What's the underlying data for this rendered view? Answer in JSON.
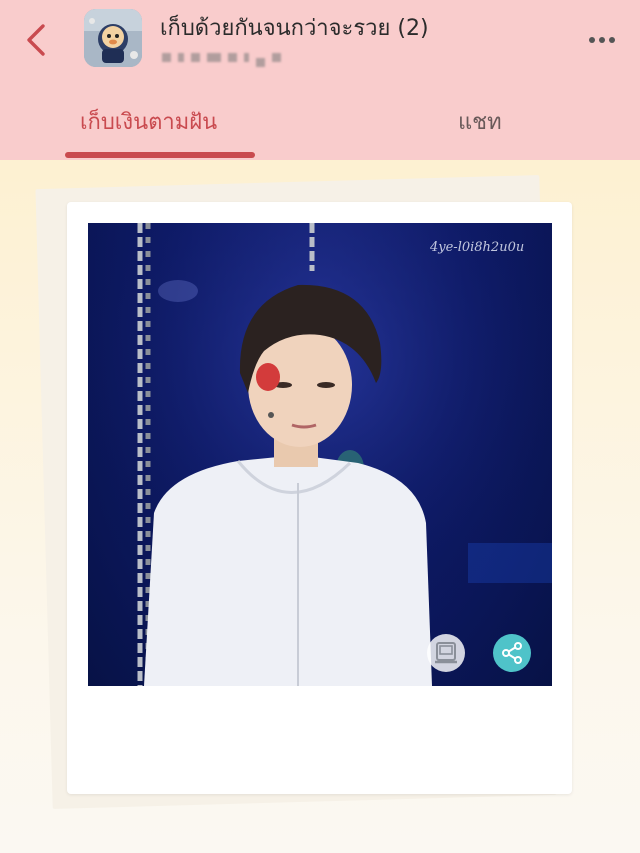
{
  "header": {
    "chat_title": "เก็บด้วยกันจนกว่าจะรวย (2)",
    "subtitle_hidden": true,
    "background_color": "#f9cccc"
  },
  "tabs": [
    {
      "label": "เก็บเงินตามฝัน",
      "active": true
    },
    {
      "label": "แชท",
      "active": false
    }
  ],
  "photo": {
    "watermark": "4ye-l0i8h2u0u"
  },
  "icons": {
    "back": "chevron-left-icon",
    "more": "more-dots-icon",
    "polaroid": "polaroid-camera-icon",
    "share": "share-icon"
  },
  "colors": {
    "accent": "#c94a4f",
    "share_button": "#4fc3c9"
  }
}
